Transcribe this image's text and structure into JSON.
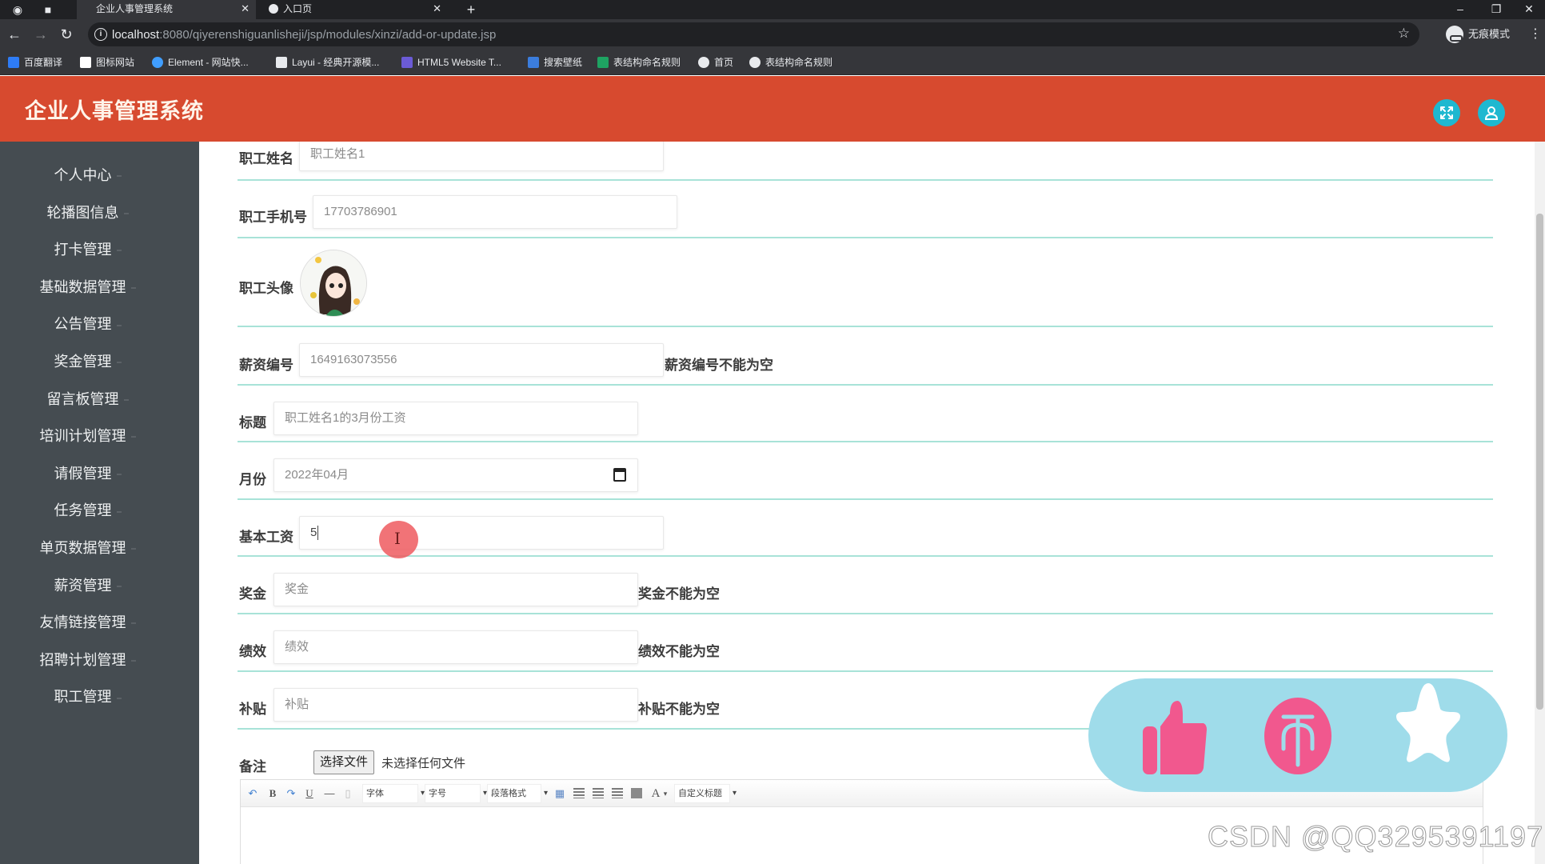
{
  "browser": {
    "tabs": [
      {
        "title": "企业人事管理系统",
        "active": true
      },
      {
        "title": "入口页",
        "active": false
      }
    ],
    "new_tab": "+",
    "url_host": "localhost",
    "url_rest": ":8080/qiyerenshiguanlisheji/jsp/modules/xinzi/add-or-update.jsp",
    "incognito_label": "无痕模式",
    "bookmarks": [
      {
        "label": "百度翻译",
        "icon": "baidu-translate-icon",
        "color": "#2e7cf6"
      },
      {
        "label": "图标网站",
        "icon": "flag-icon",
        "color": "#ffffff"
      },
      {
        "label": "Element - 网站快...",
        "icon": "element-icon",
        "color": "#409eff"
      },
      {
        "label": "Layui - 经典开源模...",
        "icon": "layui-icon",
        "color": "#e8eaed"
      },
      {
        "label": "HTML5 Website T...",
        "icon": "html5-icon",
        "color": "#6b5bd6"
      },
      {
        "label": "搜索壁纸",
        "icon": "wallpaper-icon",
        "color": "#3b7ddd"
      },
      {
        "label": "表结构命名规则",
        "icon": "sheet-icon",
        "color": "#1ea362"
      },
      {
        "label": "首页",
        "icon": "globe-icon",
        "color": "#e8eaed"
      },
      {
        "label": "表结构命名规则",
        "icon": "globe-icon",
        "color": "#e8eaed"
      }
    ]
  },
  "app": {
    "title": "企业人事管理系统",
    "brand_color": "#d74a2f",
    "accent_color": "#1fb8d0"
  },
  "sidebar": {
    "items": [
      {
        "label": "个人中心"
      },
      {
        "label": "轮播图信息"
      },
      {
        "label": "打卡管理"
      },
      {
        "label": "基础数据管理"
      },
      {
        "label": "公告管理"
      },
      {
        "label": "奖金管理"
      },
      {
        "label": "留言板管理"
      },
      {
        "label": "培训计划管理"
      },
      {
        "label": "请假管理"
      },
      {
        "label": "任务管理"
      },
      {
        "label": "单页数据管理"
      },
      {
        "label": "薪资管理"
      },
      {
        "label": "友情链接管理"
      },
      {
        "label": "招聘计划管理"
      },
      {
        "label": "职工管理"
      }
    ]
  },
  "form": {
    "name": {
      "label": "职工姓名",
      "value": "职工姓名1"
    },
    "phone": {
      "label": "职工手机号",
      "value": "17703786901"
    },
    "avatar": {
      "label": "职工头像"
    },
    "salary_no": {
      "label": "薪资编号",
      "value": "1649163073556",
      "error": "薪资编号不能为空"
    },
    "title": {
      "label": "标题",
      "value": "职工姓名1的3月份工资"
    },
    "month": {
      "label": "月份",
      "value": "2022年04月"
    },
    "base_salary": {
      "label": "基本工资",
      "value": "5"
    },
    "bonus": {
      "label": "奖金",
      "placeholder": "奖金",
      "error": "奖金不能为空"
    },
    "performance": {
      "label": "绩效",
      "placeholder": "绩效",
      "error": "绩效不能为空"
    },
    "subsidy": {
      "label": "补贴",
      "placeholder": "补贴",
      "error": "补贴不能为空"
    },
    "remark": {
      "label": "备注",
      "file_button": "选择文件",
      "file_status": "未选择任何文件"
    }
  },
  "editor_toolbar": {
    "bold": "B",
    "underline": "U",
    "font_family": "字体",
    "font_size": "字号",
    "paragraph": "段落格式",
    "font_color": "A",
    "custom_title": "自定义标题"
  },
  "watermark": "CSDN @QQ3295391197"
}
